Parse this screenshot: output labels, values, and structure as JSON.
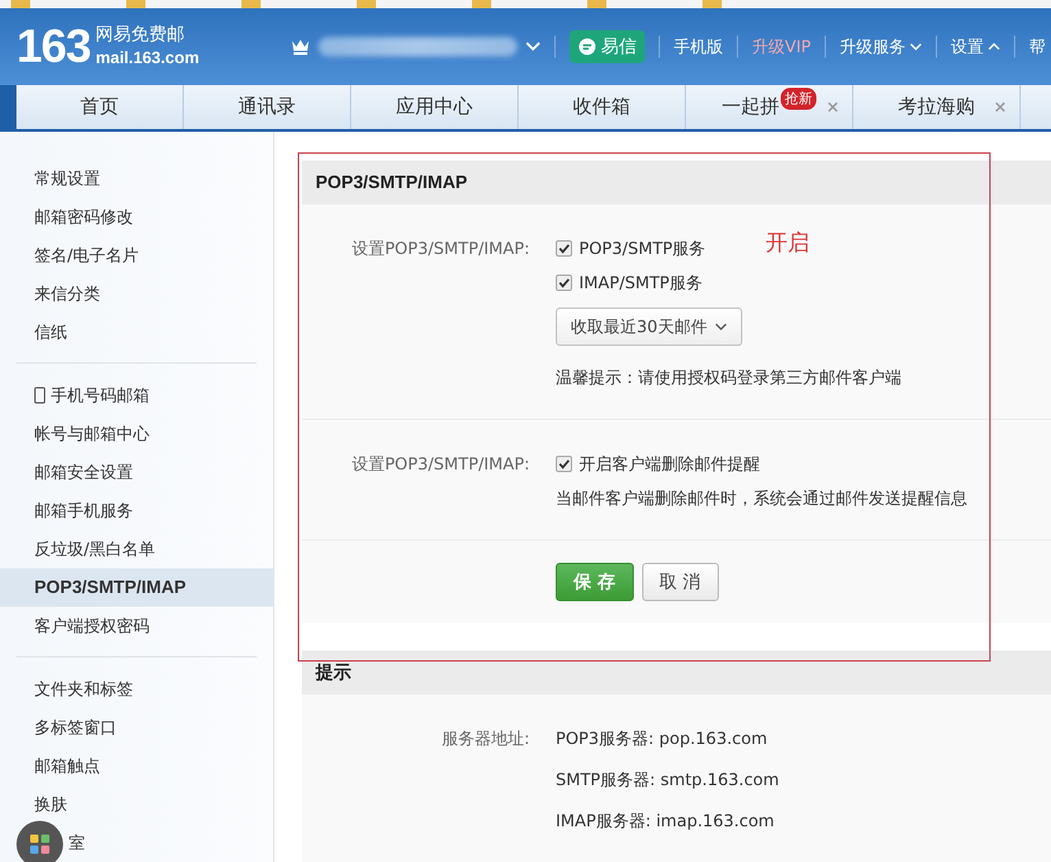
{
  "header": {
    "logo_number": "163",
    "logo_name": "网易免费邮",
    "logo_domain": "mail.163.com",
    "links": [
      {
        "label": "易信",
        "kind": "badge"
      },
      {
        "label": "手机版",
        "kind": "link"
      },
      {
        "label": "升级VIP",
        "kind": "vip"
      },
      {
        "label": "升级服务",
        "kind": "menu",
        "expanded": false
      },
      {
        "label": "设置",
        "kind": "menu",
        "expanded": true
      },
      {
        "label": "帮",
        "kind": "link"
      }
    ]
  },
  "tabs": [
    {
      "label": "首页",
      "closable": false
    },
    {
      "label": "通讯录",
      "closable": false
    },
    {
      "label": "应用中心",
      "closable": false
    },
    {
      "label": "收件箱",
      "closable": false
    },
    {
      "label": "一起拼",
      "closable": true,
      "badge": "抢新"
    },
    {
      "label": "考拉海购",
      "closable": true
    }
  ],
  "sidebar": {
    "groups": [
      [
        {
          "label": "常规设置",
          "selected": false
        },
        {
          "label": "邮箱密码修改",
          "selected": false
        },
        {
          "label": "签名/电子名片",
          "selected": false
        },
        {
          "label": "来信分类",
          "selected": false
        },
        {
          "label": "信纸",
          "selected": false
        }
      ],
      [
        {
          "label": "手机号码邮箱",
          "selected": false,
          "kind": "phone"
        },
        {
          "label": "帐号与邮箱中心",
          "selected": false
        },
        {
          "label": "邮箱安全设置",
          "selected": false
        },
        {
          "label": "邮箱手机服务",
          "selected": false
        },
        {
          "label": "反垃圾/黑白名单",
          "selected": false
        },
        {
          "label": "POP3/SMTP/IMAP",
          "selected": true
        },
        {
          "label": "客户端授权密码",
          "selected": false
        }
      ],
      [
        {
          "label": "文件夹和标签",
          "selected": false
        },
        {
          "label": "多标签窗口",
          "selected": false
        },
        {
          "label": "邮箱触点",
          "selected": false
        },
        {
          "label": "换肤",
          "selected": false
        },
        {
          "label": "室",
          "selected": false,
          "kind": "partial"
        }
      ]
    ]
  },
  "settings": {
    "title": "POP3/SMTP/IMAP",
    "annotation": "开启",
    "rows": [
      {
        "label": "设置POP3/SMTP/IMAP:",
        "checkboxes": [
          {
            "label": "POP3/SMTP服务",
            "checked": true
          },
          {
            "label": "IMAP/SMTP服务",
            "checked": true
          }
        ],
        "dropdown": "收取最近30天邮件",
        "note": "温馨提示：请使用授权码登录第三方邮件客户端"
      },
      {
        "label": "设置POP3/SMTP/IMAP:",
        "checkboxes": [
          {
            "label": "开启客户端删除邮件提醒",
            "checked": true
          }
        ],
        "note": "当邮件客户端删除邮件时，系统会通过邮件发送提醒信息"
      }
    ],
    "buttons": [
      {
        "label": "保 存",
        "kind": "primary"
      },
      {
        "label": "取 消",
        "kind": "secondary"
      }
    ]
  },
  "tips": {
    "title": "提示",
    "label": "服务器地址:",
    "lines": [
      "POP3服务器: pop.163.com",
      "SMTP服务器: smtp.163.com",
      "IMAP服务器: imap.163.com"
    ]
  }
}
